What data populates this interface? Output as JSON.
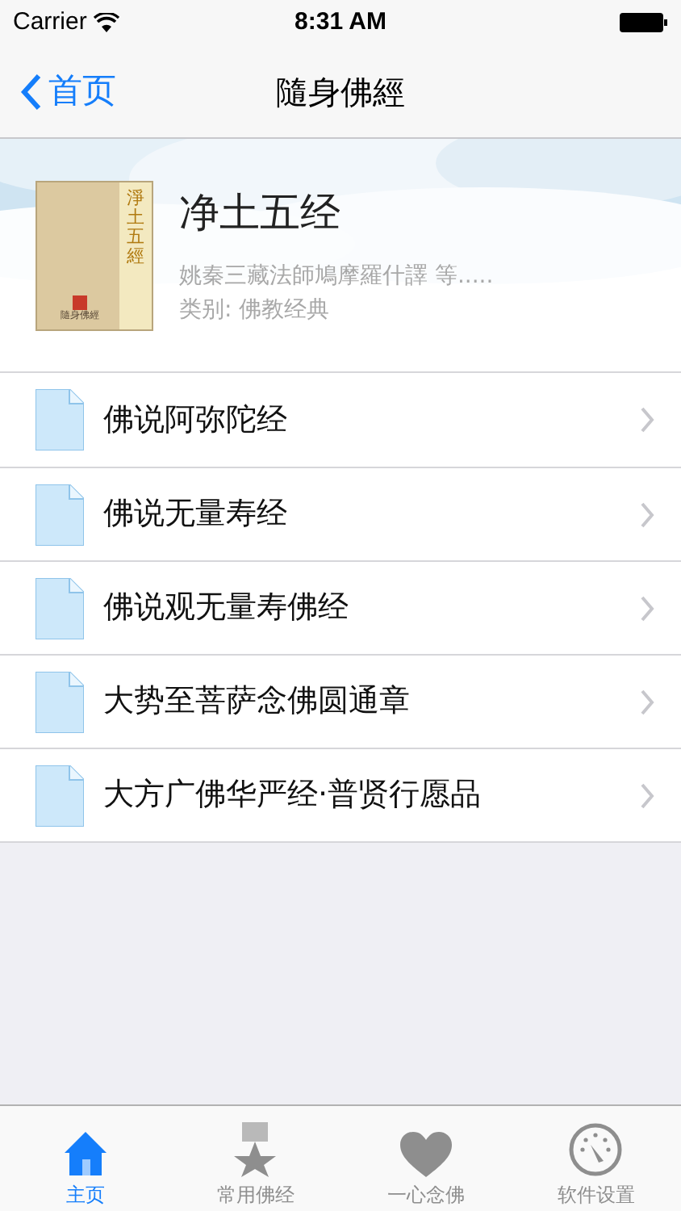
{
  "status_bar": {
    "carrier": "Carrier",
    "time": "8:31 AM"
  },
  "nav": {
    "back": "首页",
    "title": "隨身佛經"
  },
  "header": {
    "cover": {
      "title": "淨土五經",
      "footer": "隨身佛經"
    },
    "title": "净土五经",
    "author": "姚秦三藏法師鳩摩羅什譯 等.....",
    "category": "类别: 佛教经典"
  },
  "items": [
    {
      "label": "佛说阿弥陀经"
    },
    {
      "label": "佛说无量寿经"
    },
    {
      "label": "佛说观无量寿佛经"
    },
    {
      "label": "大势至菩萨念佛圆通章"
    },
    {
      "label": "大方广佛华严经·普贤行愿品"
    }
  ],
  "tabs": [
    {
      "label": "主页",
      "kind": "home",
      "selected": true
    },
    {
      "label": "常用佛经",
      "kind": "medal",
      "selected": false
    },
    {
      "label": "一心念佛",
      "kind": "heart",
      "selected": false
    },
    {
      "label": "软件设置",
      "kind": "gauge",
      "selected": false
    }
  ]
}
